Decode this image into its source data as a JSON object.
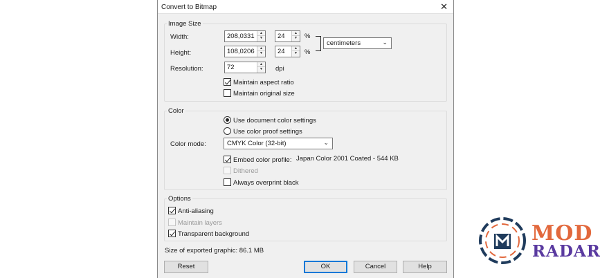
{
  "dialog": {
    "title": "Convert to Bitmap",
    "close_glyph": "✕"
  },
  "image_size": {
    "group_label": "Image Size",
    "width_label": "Width:",
    "width_value": "208,0331",
    "width_percent": "24",
    "height_label": "Height:",
    "height_value": "108,0206",
    "height_percent": "24",
    "percent_sign": "%",
    "units_value": "centimeters",
    "resolution_label": "Resolution:",
    "resolution_value": "72",
    "resolution_unit": "dpi",
    "maintain_aspect_label": "Maintain aspect ratio",
    "maintain_aspect_checked": true,
    "maintain_original_label": "Maintain original size",
    "maintain_original_checked": false
  },
  "color": {
    "group_label": "Color",
    "use_document_label": "Use document color settings",
    "use_proof_label": "Use color proof settings",
    "selected_option": "document",
    "color_mode_label": "Color mode:",
    "color_mode_value": "CMYK Color (32-bit)",
    "embed_profile_label": "Embed color profile:",
    "embed_profile_checked": true,
    "profile_name": "Japan Color 2001 Coated - 544 KB",
    "dithered_label": "Dithered",
    "dithered_enabled": false,
    "overprint_label": "Always overprint black",
    "overprint_checked": false
  },
  "options": {
    "group_label": "Options",
    "anti_aliasing_label": "Anti-aliasing",
    "anti_aliasing_checked": true,
    "maintain_layers_label": "Maintain layers",
    "maintain_layers_enabled": false,
    "transparent_bg_label": "Transparent background",
    "transparent_bg_checked": true
  },
  "export_size_text": "Size of exported graphic: 86.1 MB",
  "buttons": {
    "reset": "Reset",
    "ok": "OK",
    "cancel": "Cancel",
    "help": "Help"
  },
  "watermark": {
    "line1": "MOD",
    "line2": "RADAR",
    "line1_color": "#e2683c",
    "line2_color": "#5a3aa0",
    "icon_color": "#1f3b5c"
  }
}
